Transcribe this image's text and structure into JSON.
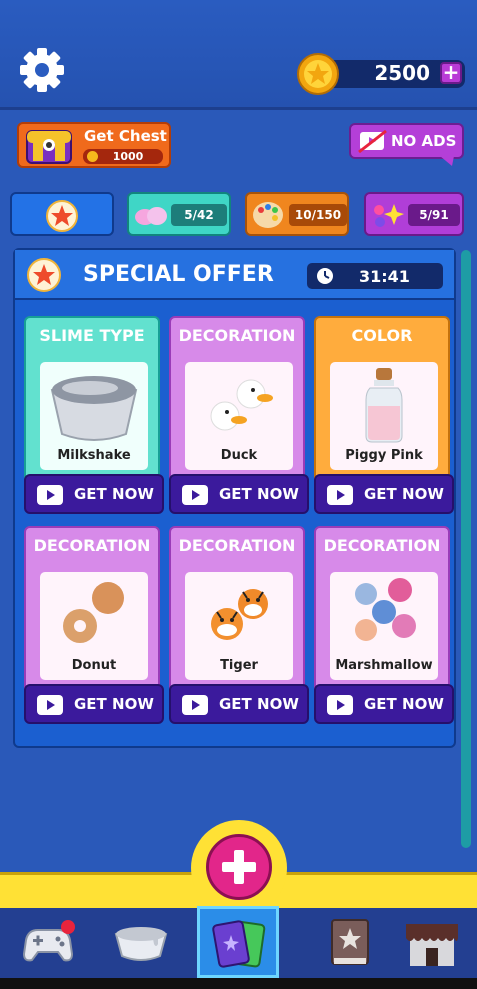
{
  "header": {
    "coins": "2500",
    "plus_label": "+"
  },
  "chest": {
    "title": "Get Chest",
    "price": "1000"
  },
  "no_ads": {
    "label": "NO ADS"
  },
  "tabs": [
    {
      "name": "favorites",
      "count": ""
    },
    {
      "name": "slime",
      "count": "5/42"
    },
    {
      "name": "color",
      "count": "10/150"
    },
    {
      "name": "decoration",
      "count": "5/91"
    }
  ],
  "offer": {
    "title": "SPECIAL OFFER",
    "timer": "31:41"
  },
  "cards": [
    {
      "category": "SLIME TYPE",
      "item": "Milkshake",
      "button": "GET NOW"
    },
    {
      "category": "DECORATION",
      "item": "Duck",
      "button": "GET NOW"
    },
    {
      "category": "COLOR",
      "item": "Piggy Pink",
      "button": "GET NOW"
    },
    {
      "category": "DECORATION",
      "item": "Donut",
      "button": "GET NOW"
    },
    {
      "category": "DECORATION",
      "item": "Tiger",
      "button": "GET NOW"
    },
    {
      "category": "DECORATION",
      "item": "Marshmallow",
      "button": "GET NOW"
    }
  ],
  "colors": {
    "background": "#2a59b9",
    "slime_card": "#62e1cf",
    "decoration_card": "#d78ae9",
    "color_card": "#ffac3d",
    "button": "#3b1a9c",
    "accent_yellow": "#ffe135"
  },
  "nav": [
    {
      "icon": "gamepad-icon"
    },
    {
      "icon": "slime-bowl-icon"
    },
    {
      "icon": "cards-icon"
    },
    {
      "icon": "book-icon"
    },
    {
      "icon": "shop-icon"
    }
  ]
}
